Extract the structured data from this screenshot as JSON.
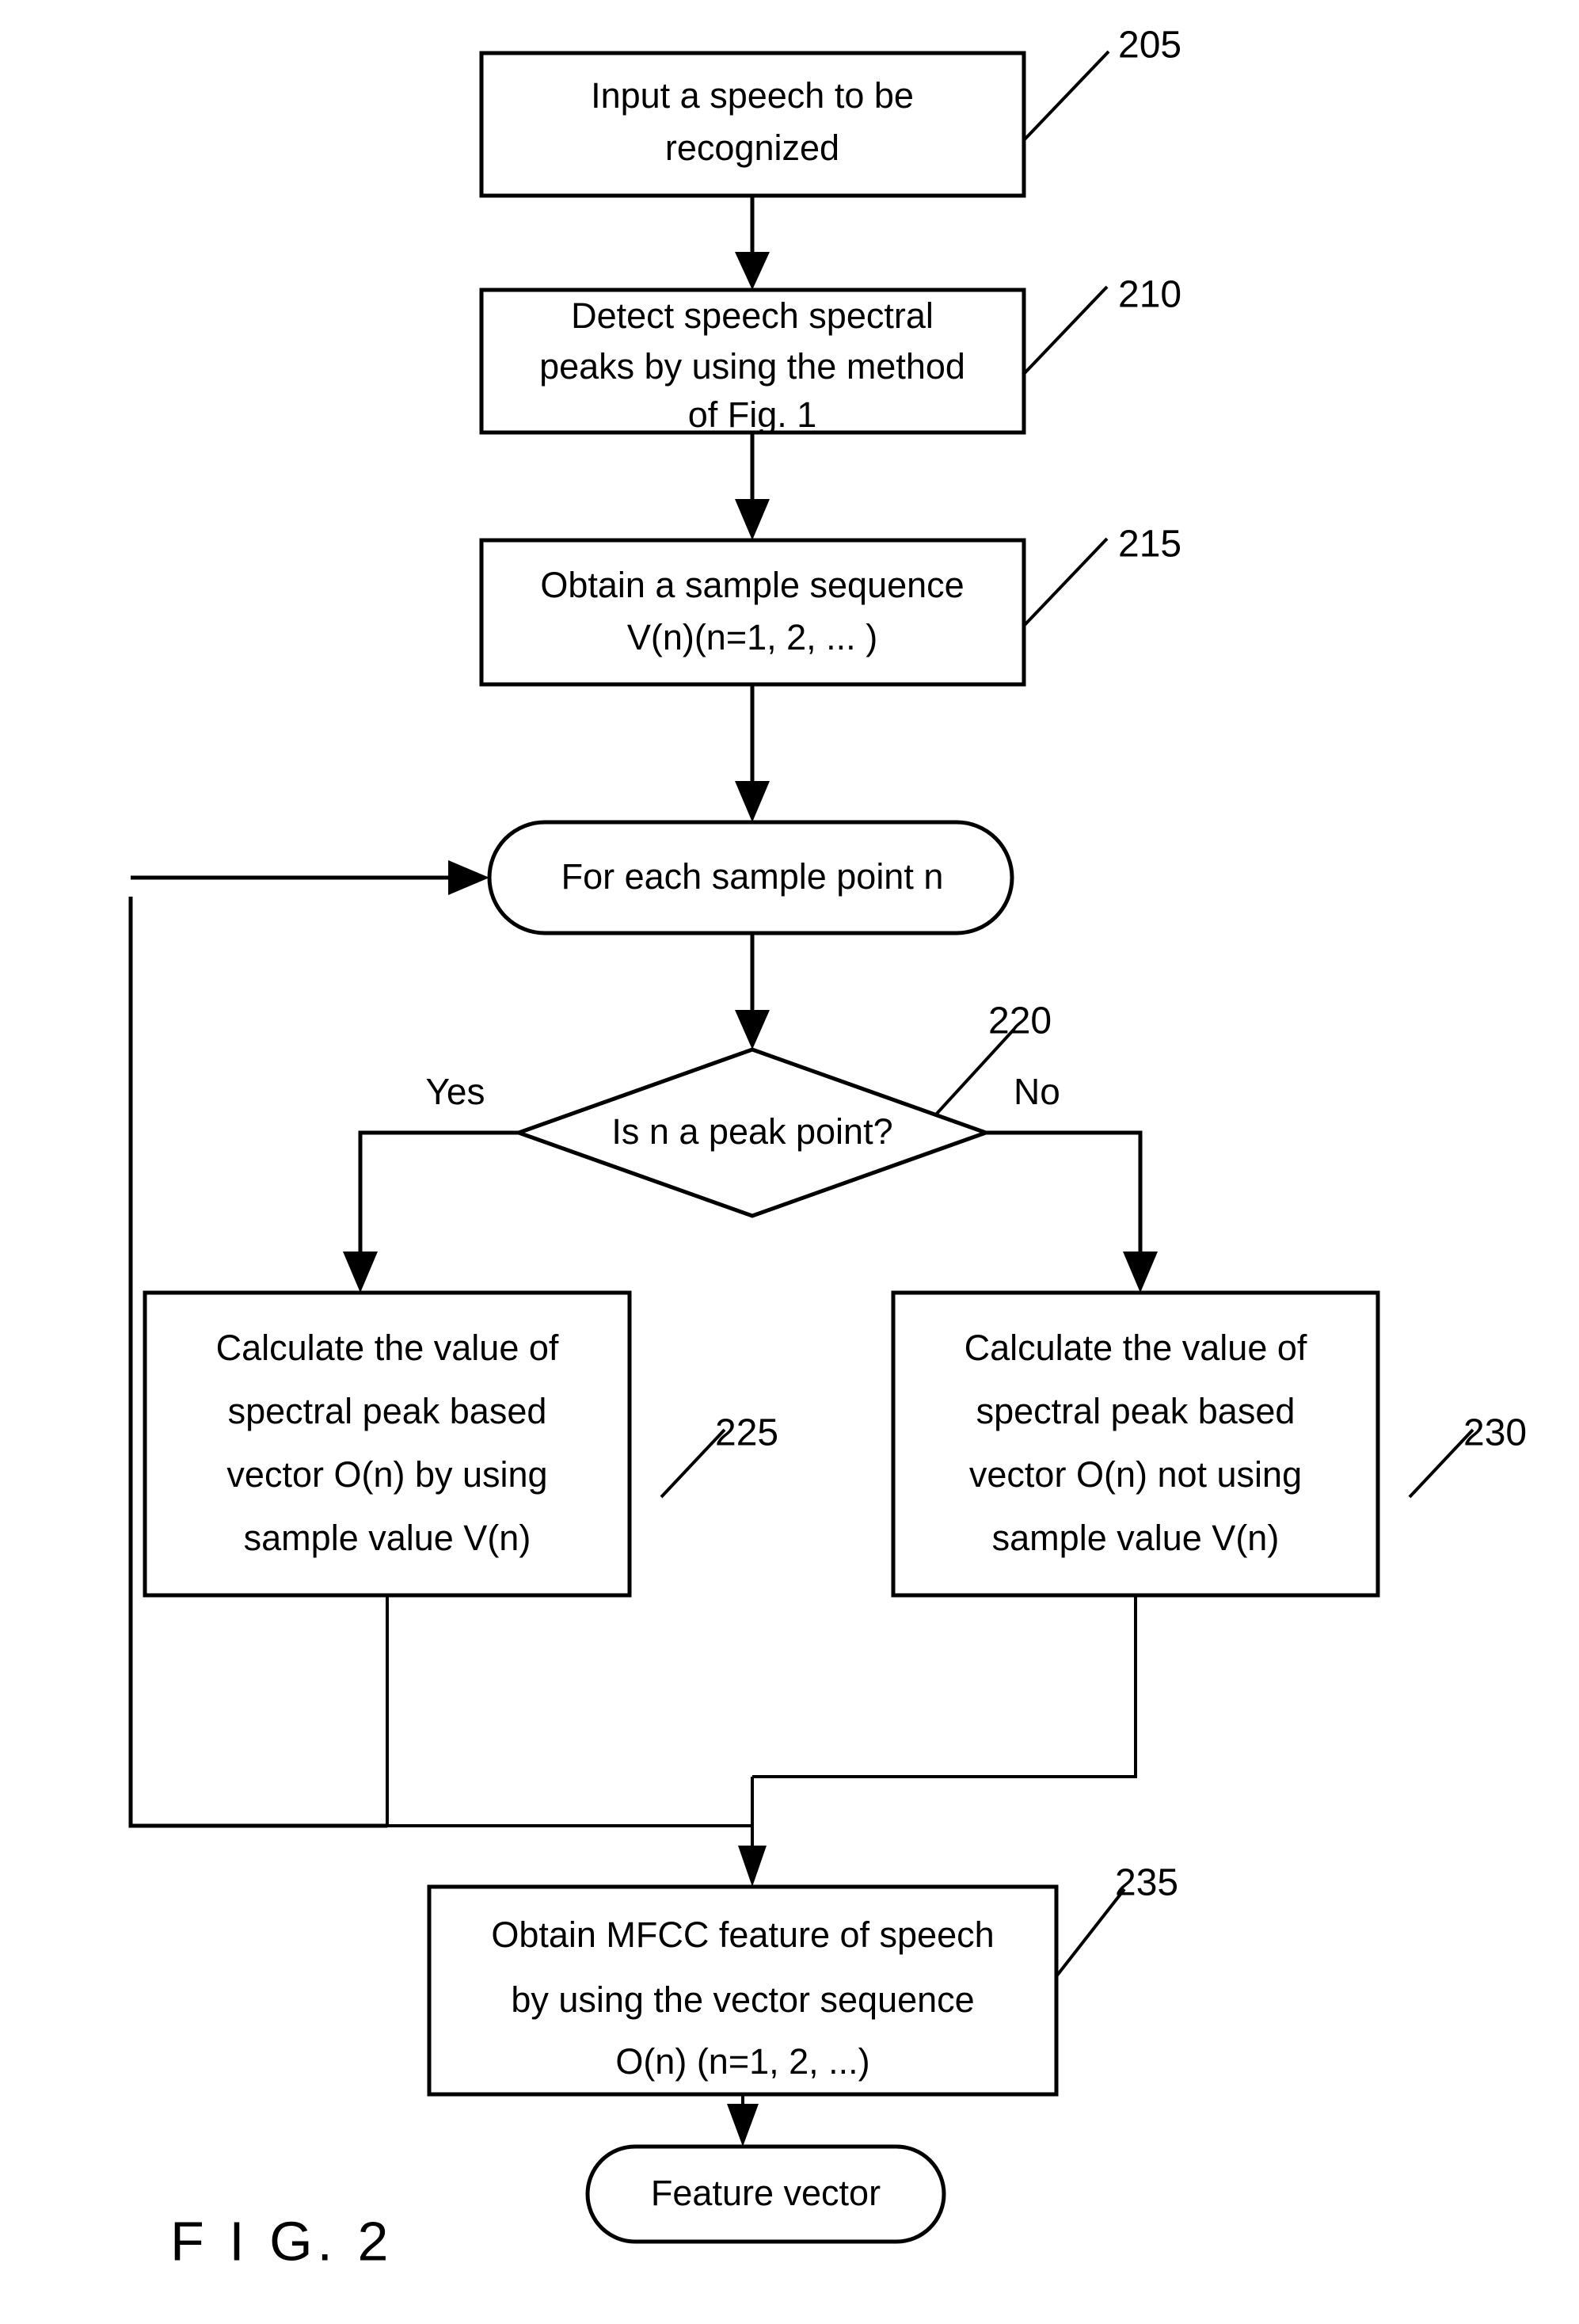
{
  "figure": {
    "caption": "F I G. 2",
    "title": "Speech recognition feature extraction flowchart"
  },
  "nodes": {
    "input_speech": {
      "ref": "205",
      "shape": "process",
      "lines": [
        "Input a speech to be",
        "recognized"
      ]
    },
    "detect_peaks": {
      "ref": "210",
      "shape": "process",
      "lines": [
        "Detect speech spectral",
        "peaks by using the method",
        "of Fig. 1"
      ]
    },
    "obtain_sequence": {
      "ref": "215",
      "shape": "process",
      "lines": [
        "Obtain a sample sequence",
        "V(n)(n=1, 2, ... )"
      ]
    },
    "loop_start": {
      "ref": "",
      "shape": "rounded",
      "lines": [
        "For each sample point n"
      ]
    },
    "decision_peak": {
      "ref": "220",
      "shape": "diamond",
      "lines": [
        "Is n a peak point?"
      ]
    },
    "calc_using": {
      "ref": "225",
      "shape": "process",
      "lines": [
        "Calculate the value of",
        "spectral peak based",
        "vector O(n) by using",
        "sample value V(n)"
      ]
    },
    "calc_not_using": {
      "ref": "230",
      "shape": "process",
      "lines": [
        "Calculate the value of",
        "spectral peak based",
        "vector O(n) not using",
        "sample value V(n)"
      ]
    },
    "obtain_mfcc": {
      "ref": "235",
      "shape": "process",
      "lines": [
        "Obtain MFCC feature of speech",
        "by using the vector sequence",
        "O(n) (n=1, 2, ...)"
      ]
    },
    "feature_vector": {
      "ref": "",
      "shape": "rounded",
      "lines": [
        "Feature vector"
      ]
    }
  },
  "branch_labels": {
    "yes": "Yes",
    "no": "No"
  },
  "colors": {
    "stroke": "#000000",
    "fill": "#ffffff",
    "text": "#000000"
  }
}
